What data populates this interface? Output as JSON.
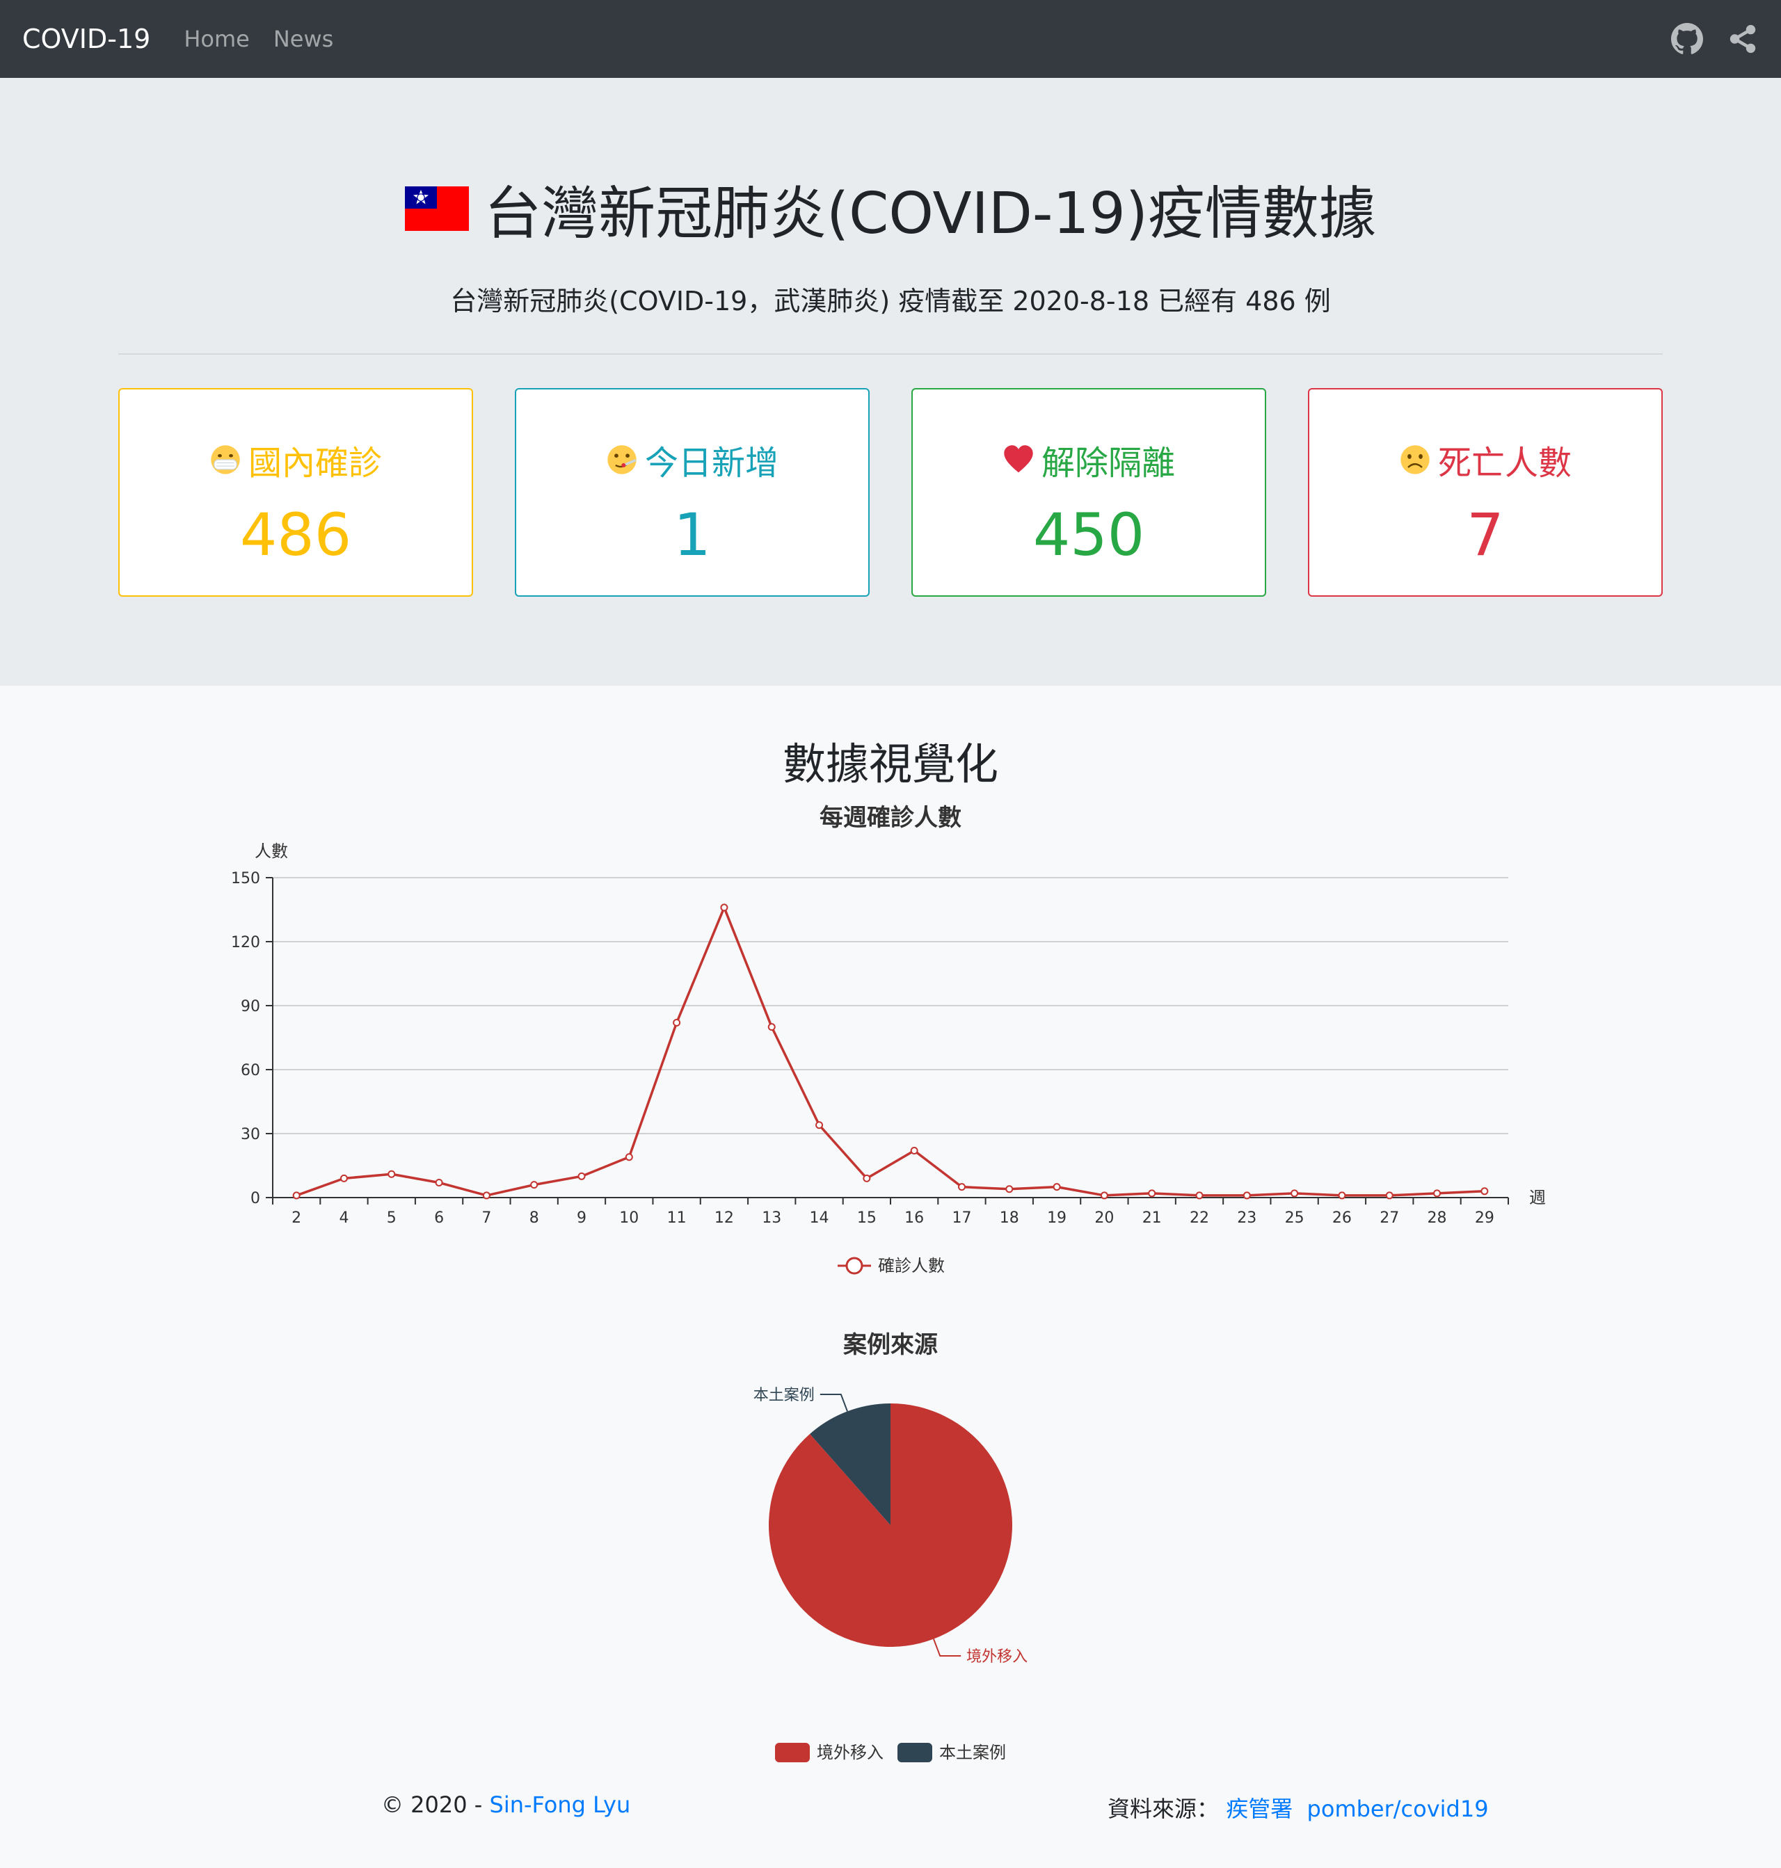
{
  "navbar": {
    "brand": "COVID-19",
    "links": [
      "Home",
      "News"
    ],
    "icons": [
      "github-icon",
      "share-icon"
    ]
  },
  "hero": {
    "title": "台灣新冠肺炎(COVID-19)疫情數據",
    "subtitle": "台灣新冠肺炎(COVID-19，武漢肺炎) 疫情截至 2020-8-18 已經有 486 例"
  },
  "cards": [
    {
      "emoji": "mask-face-icon",
      "label": "國內確診",
      "value": "486",
      "color": "#ffc107"
    },
    {
      "emoji": "thermometer-face-icon",
      "label": "今日新增",
      "value": "1",
      "color": "#17a2b8"
    },
    {
      "emoji": "heart-icon",
      "label": "解除隔離",
      "value": "450",
      "color": "#28a745"
    },
    {
      "emoji": "frowning-face-icon",
      "label": "死亡人數",
      "value": "7",
      "color": "#dc3545"
    }
  ],
  "viz": {
    "heading": "數據視覺化"
  },
  "chart_data": [
    {
      "type": "line",
      "title": "每週確診人數",
      "xlabel": "週",
      "ylabel": "人數",
      "ylim": [
        0,
        150
      ],
      "yticks": [
        0,
        30,
        60,
        90,
        120,
        150
      ],
      "categories": [
        "2",
        "4",
        "5",
        "6",
        "7",
        "8",
        "9",
        "10",
        "11",
        "12",
        "13",
        "14",
        "15",
        "16",
        "17",
        "18",
        "19",
        "20",
        "21",
        "22",
        "23",
        "25",
        "26",
        "27",
        "28",
        "29"
      ],
      "series": [
        {
          "name": "確診人數",
          "color": "#c23531",
          "values": [
            1,
            9,
            11,
            7,
            1,
            6,
            10,
            19,
            82,
            136,
            80,
            34,
            9,
            22,
            5,
            4,
            5,
            1,
            2,
            1,
            1,
            2,
            1,
            1,
            2,
            3
          ]
        }
      ],
      "grid": true,
      "legend": "bottom-center"
    },
    {
      "type": "pie",
      "title": "案例來源",
      "slices": [
        {
          "label": "境外移入",
          "value": 430,
          "color": "#c23531"
        },
        {
          "label": "本土案例",
          "value": 56,
          "color": "#2f4554"
        }
      ],
      "legend": "bottom-center"
    }
  ],
  "footer": {
    "copyright": "© 2020 - ",
    "author": "Sin-Fong Lyu",
    "source_label": "資料來源：",
    "source_links": [
      "疾管署",
      "pomber/covid19"
    ]
  }
}
